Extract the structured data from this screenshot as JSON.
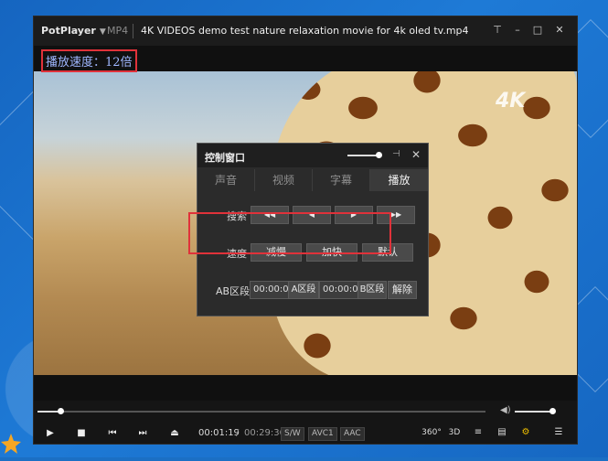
{
  "window": {
    "app_name": "PotPlayer",
    "format": "MP4",
    "file_title": "4K VIDEOS demo test nature relaxation movie for 4k oled tv.mp4",
    "controls": {
      "pin": "⊤",
      "minimize": "–",
      "maximize": "□",
      "close": "✕"
    }
  },
  "osd": {
    "text": "播放速度：12倍"
  },
  "video": {
    "badge": "4K"
  },
  "control_panel": {
    "title": "控制窗口",
    "volume_level": 0.85,
    "tabs": [
      {
        "label": "声音",
        "active": false
      },
      {
        "label": "视频",
        "active": false
      },
      {
        "label": "字幕",
        "active": false
      },
      {
        "label": "播放",
        "active": true
      }
    ],
    "search": {
      "label": "搜索",
      "buttons": [
        "◀◀",
        "◀",
        "▶",
        "▶▶"
      ]
    },
    "speed": {
      "label": "速度",
      "decrease": "减慢",
      "increase": "加快",
      "default": "默认"
    },
    "ab": {
      "label": "AB区段",
      "a_time": "00:00:00",
      "a_button": "A区段",
      "b_time": "00:00:00",
      "b_button": "B区段",
      "release": "解除"
    }
  },
  "bottom_bar": {
    "seek_progress": 0.05,
    "volume_level": 1.0,
    "current_time": "00:01:19",
    "separator": "/",
    "total_time": "00:29:36",
    "tags": [
      "S/W",
      "AVC1",
      "AAC"
    ],
    "right_icons": {
      "vr": "360°",
      "three_d": "3D",
      "subtitle": "≡",
      "capture": "▤",
      "settings": "⚙",
      "menu": "☰"
    }
  },
  "colors": {
    "highlight": "#e0323a",
    "accent_blue": "#1b6fc4"
  }
}
